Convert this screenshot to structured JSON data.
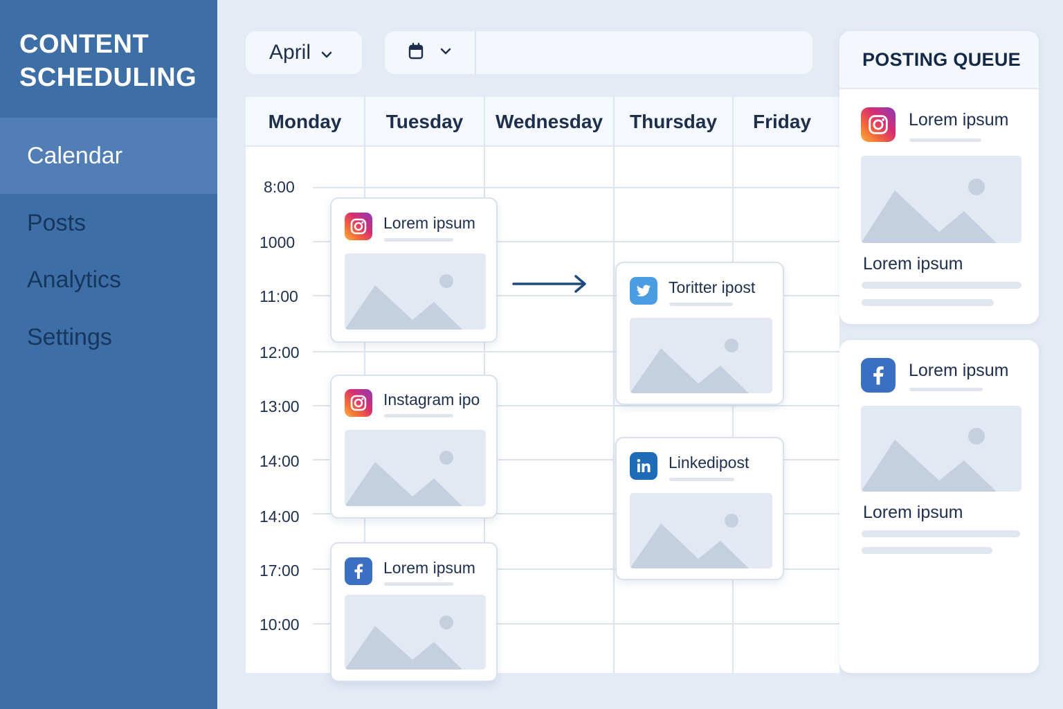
{
  "sidebar": {
    "title_line1": "CONTENT",
    "title_line2": "SCHEDULING",
    "items": [
      {
        "label": "Calendar",
        "active": true
      },
      {
        "label": "Posts",
        "active": false
      },
      {
        "label": "Analytics",
        "active": false
      },
      {
        "label": "Settings",
        "active": false
      }
    ]
  },
  "toolbar": {
    "month": "April",
    "month_icon": "chevron-down-icon",
    "date_icon": "calendar-icon",
    "search_value": ""
  },
  "calendar": {
    "days": [
      "Monday",
      "Tuesday",
      "Wednesday",
      "Thursday",
      "Friday"
    ],
    "times": [
      "8:00",
      "1000",
      "11:00",
      "12:00",
      "13:00",
      "14:00",
      "14:00",
      "17:00",
      "10:00"
    ]
  },
  "posts": [
    {
      "network": "instagram",
      "icon": "instagram-icon",
      "title": "Lorem ipsum"
    },
    {
      "network": "instagram",
      "icon": "instagram-icon",
      "title": "Instagram ipo"
    },
    {
      "network": "facebook",
      "icon": "facebook-icon",
      "title": "Lorem ipsum"
    },
    {
      "network": "twitter",
      "icon": "twitter-icon",
      "title": "Toritter ipost"
    },
    {
      "network": "linkedin",
      "icon": "linkedin-icon",
      "title": "Linkedipost"
    }
  ],
  "queue": {
    "title": "POSTING QUEUE",
    "items": [
      {
        "network": "instagram",
        "icon": "instagram-icon",
        "title": "Lorem ipsum",
        "caption": "Lorem ipsum"
      },
      {
        "network": "facebook",
        "icon": "facebook-icon",
        "title": "Lorem ipsum",
        "caption": "Lorem ipsum"
      }
    ]
  },
  "colors": {
    "sidebar": "#3d6ea6",
    "sidebar_active": "#517fb5",
    "background": "#e4ebf5",
    "text_dark": "#1d2f4d",
    "arrow": "#1f4a7c"
  }
}
